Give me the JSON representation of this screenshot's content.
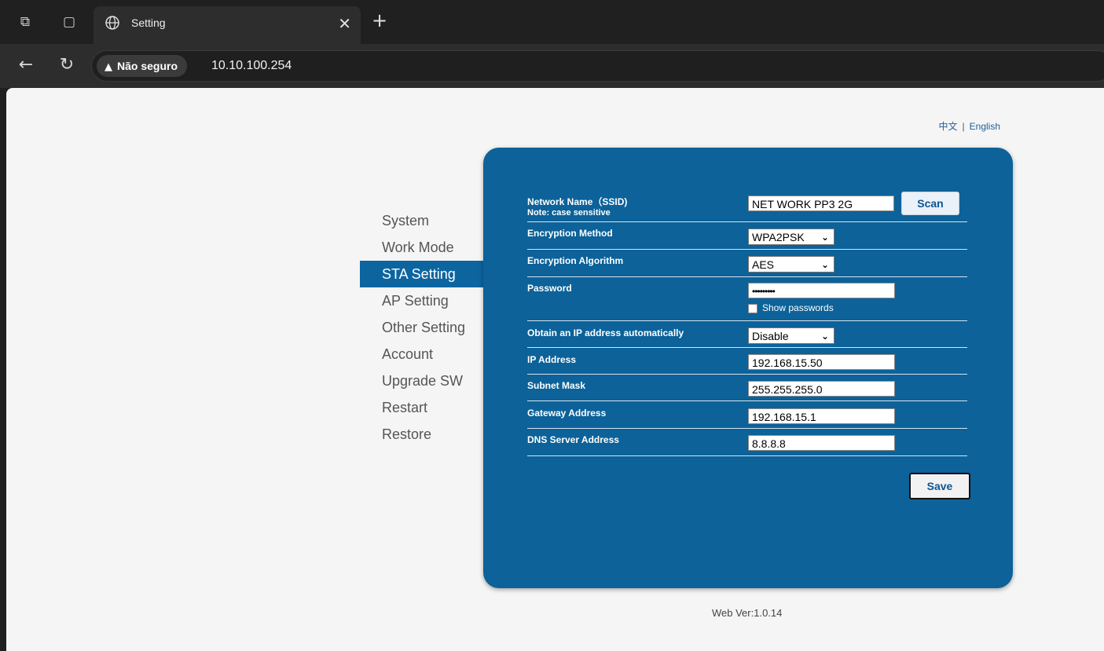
{
  "browser": {
    "tab_title": "Setting",
    "security_label": "Não seguro",
    "url": "10.10.100.254"
  },
  "lang": {
    "chinese": "中文",
    "separator": "|",
    "english": "English"
  },
  "menu": {
    "items": [
      {
        "label": "System"
      },
      {
        "label": "Work Mode"
      },
      {
        "label": "STA Setting"
      },
      {
        "label": "AP Setting"
      },
      {
        "label": "Other Setting"
      },
      {
        "label": "Account"
      },
      {
        "label": "Upgrade SW"
      },
      {
        "label": "Restart"
      },
      {
        "label": "Restore"
      }
    ],
    "active": "STA Setting"
  },
  "form": {
    "ssid_label": "Network Name（SSID)",
    "ssid_note": "Note: case sensitive",
    "ssid_value": "NET WORK PP3 2G",
    "scan_label": "Scan",
    "encryption_method_label": "Encryption Method",
    "encryption_method_value": "WPA2PSK",
    "encryption_algorithm_label": "Encryption Algorithm",
    "encryption_algorithm_value": "AES",
    "password_label": "Password",
    "password_value": "•••••••••",
    "show_passwords_label": "Show passwords",
    "dhcp_label": "Obtain an IP address automatically",
    "dhcp_value": "Disable",
    "ip_label": "IP Address",
    "ip_value": "192.168.15.50",
    "subnet_label": "Subnet Mask",
    "subnet_value": "255.255.255.0",
    "gateway_label": "Gateway Address",
    "gateway_value": "192.168.15.1",
    "dns_label": "DNS Server Address",
    "dns_value": "8.8.8.8",
    "save_label": "Save"
  },
  "footer": {
    "version": "Web Ver:1.0.14"
  }
}
